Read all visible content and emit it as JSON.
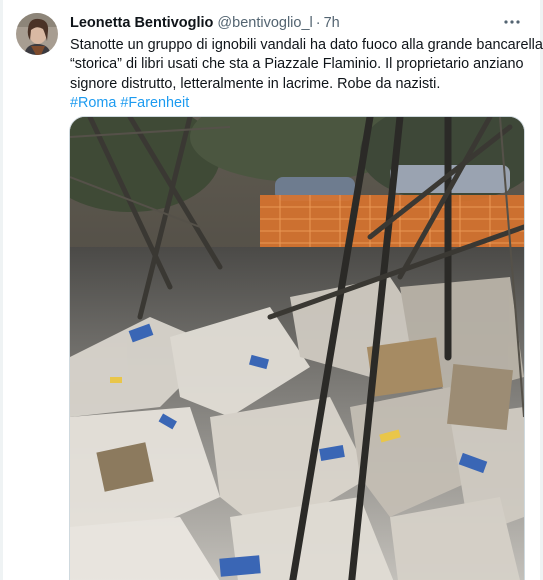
{
  "tweet": {
    "author": {
      "display_name": "Leonetta Bentivoglio",
      "handle": "@bentivoglio_l",
      "avatar_icon": "profile-photo"
    },
    "separator": "·",
    "timestamp": "7h",
    "more_icon": "ellipsis-icon",
    "text_lines": [
      "Stanotte un gruppo di ignobili vandali ha dato fuoco alla grande bancarella",
      "“storica” di libri usati che sta a Piazzale Flaminio. Il proprietario anziano",
      "signore distrutto, letteralmente in lacrime. Robe da nazisti."
    ],
    "hashtags": [
      "#Roma",
      "#Farenheit"
    ],
    "hashtag_separator": " ",
    "colors": {
      "link": "#1d9bf0",
      "secondary_text": "#536471",
      "primary_text": "#0f1419",
      "border": "#cfd9de"
    }
  }
}
